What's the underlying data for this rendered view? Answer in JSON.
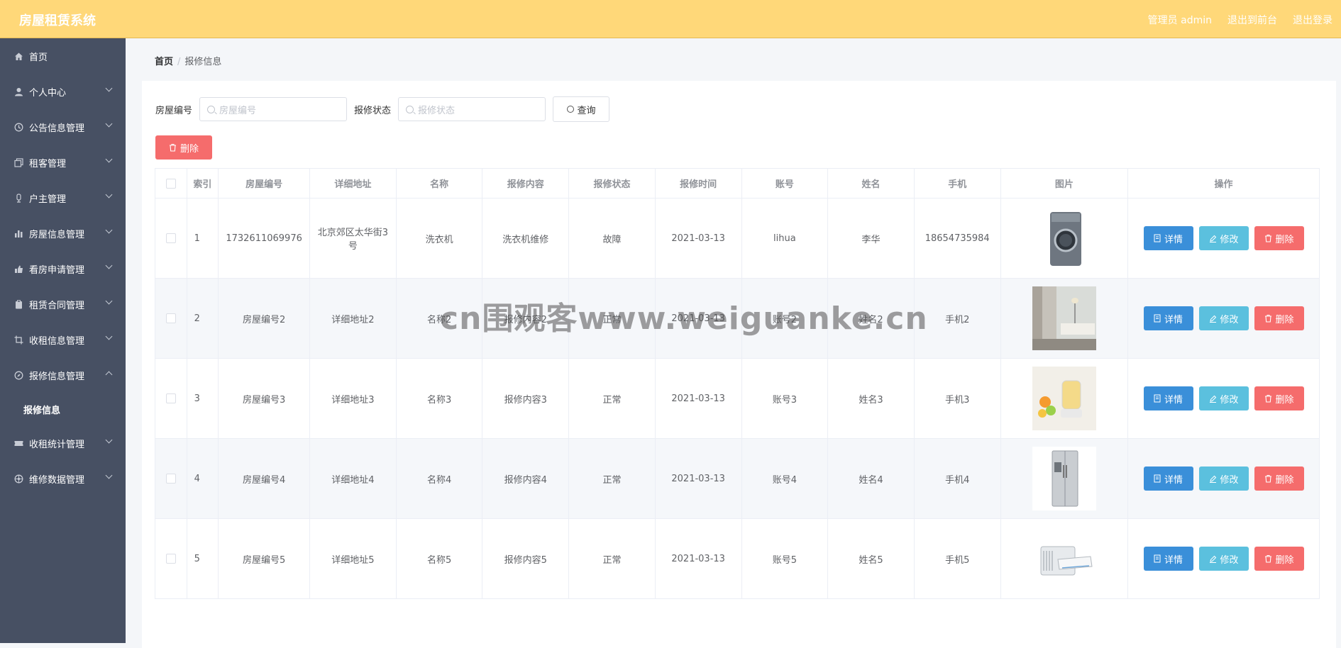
{
  "header": {
    "app_title": "房屋租赁系统",
    "admin_label": "管理员 admin",
    "back_frontend": "退出到前台",
    "logout": "退出登录"
  },
  "sidebar": {
    "items": [
      {
        "label": "首页",
        "icon": "home-icon"
      },
      {
        "label": "个人中心",
        "icon": "user-icon"
      },
      {
        "label": "公告信息管理",
        "icon": "clock-icon"
      },
      {
        "label": "租客管理",
        "icon": "copy-icon"
      },
      {
        "label": "户主管理",
        "icon": "mic-icon"
      },
      {
        "label": "房屋信息管理",
        "icon": "bar-chart-icon"
      },
      {
        "label": "看房申请管理",
        "icon": "thumb-icon"
      },
      {
        "label": "租赁合同管理",
        "icon": "clipboard-icon"
      },
      {
        "label": "收租信息管理",
        "icon": "crop-icon"
      },
      {
        "label": "报修信息管理",
        "icon": "compass-icon"
      },
      {
        "label": "收租统计管理",
        "icon": "ticket-icon"
      },
      {
        "label": "维修数据管理",
        "icon": "globe-icon"
      }
    ],
    "submenu": {
      "label": "报修信息"
    }
  },
  "breadcrumb": {
    "home": "首页",
    "separator": "/",
    "current": "报修信息"
  },
  "search": {
    "house_no_label": "房屋编号",
    "house_no_placeholder": "房屋编号",
    "status_label": "报修状态",
    "status_placeholder": "报修状态",
    "query_button": "查询"
  },
  "actions": {
    "delete_button": "删除"
  },
  "table": {
    "headers": [
      "索引",
      "房屋编号",
      "详细地址",
      "名称",
      "报修内容",
      "报修状态",
      "报修时间",
      "账号",
      "姓名",
      "手机",
      "图片",
      "操作"
    ],
    "rows": [
      {
        "idx": "1",
        "house_no": "1732611069976",
        "address": "北京郊区太华街3号",
        "name": "洗衣机",
        "content": "洗衣机维修",
        "status": "故障",
        "time": "2021-03-13",
        "account": "lihua",
        "real_name": "李华",
        "phone": "18654735984",
        "image": "washing-machine-image"
      },
      {
        "idx": "2",
        "house_no": "房屋编号2",
        "address": "详细地址2",
        "name": "名称2",
        "content": "报修内容2",
        "status": "正常",
        "time": "2021-03-13",
        "account": "账号2",
        "real_name": "姓名2",
        "phone": "手机2",
        "image": "room-interior-image"
      },
      {
        "idx": "3",
        "house_no": "房屋编号3",
        "address": "详细地址3",
        "name": "名称3",
        "content": "报修内容3",
        "status": "正常",
        "time": "2021-03-13",
        "account": "账号3",
        "real_name": "姓名3",
        "phone": "手机3",
        "image": "health-kettle-image"
      },
      {
        "idx": "4",
        "house_no": "房屋编号4",
        "address": "详细地址4",
        "name": "名称4",
        "content": "报修内容4",
        "status": "正常",
        "time": "2021-03-13",
        "account": "账号4",
        "real_name": "姓名4",
        "phone": "手机4",
        "image": "refrigerator-image"
      },
      {
        "idx": "5",
        "house_no": "房屋编号5",
        "address": "详细地址5",
        "name": "名称5",
        "content": "报修内容5",
        "status": "正常",
        "time": "2021-03-13",
        "account": "账号5",
        "real_name": "姓名5",
        "phone": "手机5",
        "image": "air-conditioner-image"
      }
    ],
    "row_actions": {
      "detail": "详情",
      "edit": "修改",
      "delete": "删除"
    }
  },
  "watermark": "cn围观客www.weiguanke.cn",
  "colors": {
    "header_bg": "#ffd879",
    "sidebar_bg": "#475063",
    "detail_btn": "#3a8fd9",
    "edit_btn": "#5bc0de",
    "delete_btn": "#f56c6c"
  }
}
